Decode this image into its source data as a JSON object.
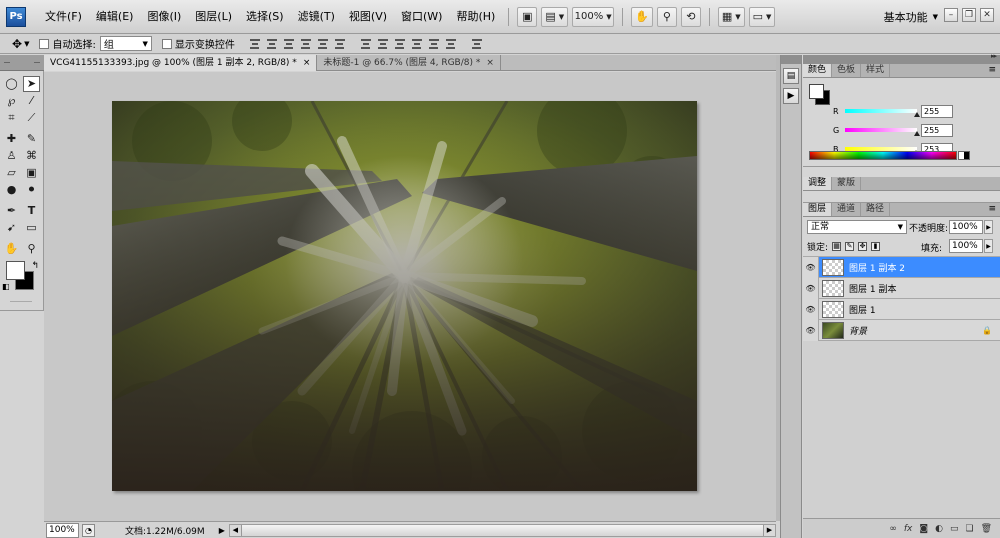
{
  "app": {
    "logo": "Ps",
    "menus": [
      "文件(F)",
      "编辑(E)",
      "图像(I)",
      "图层(L)",
      "选择(S)",
      "滤镜(T)",
      "视图(V)",
      "窗口(W)",
      "帮助(H)"
    ],
    "zoom_level": "100%",
    "workspace": "基本功能"
  },
  "options_bar": {
    "auto_select_label": "自动选择:",
    "auto_select_target": "组",
    "show_transform_label": "显示变换控件"
  },
  "documents": [
    {
      "title": "VCG41155133393.jpg @ 100% (图层 1 副本 2, RGB/8) *",
      "close": "×",
      "active": true
    },
    {
      "title": "未标题-1 @ 66.7% (图层 4, RGB/8) *",
      "close": "×",
      "active": false
    }
  ],
  "status": {
    "zoom": "100%",
    "doc_size": "文档:1.22M/6.09M"
  },
  "color_panel": {
    "tabs": [
      "颜色",
      "色板",
      "样式"
    ],
    "channels": [
      {
        "label": "R",
        "value": "255",
        "fraction": 1.0,
        "from": "#00ffff",
        "to": "#ffffff"
      },
      {
        "label": "G",
        "value": "255",
        "fraction": 1.0,
        "from": "#ff00ff",
        "to": "#ffffff"
      },
      {
        "label": "B",
        "value": "253",
        "fraction": 0.992,
        "from": "#ffff00",
        "to": "#ffffff"
      }
    ]
  },
  "adjust_panel": {
    "tabs": [
      "调整",
      "蒙版"
    ]
  },
  "layers_panel": {
    "tabs": [
      "图层",
      "通道",
      "路径"
    ],
    "blend_mode": "正常",
    "opacity_label": "不透明度:",
    "opacity": "100%",
    "lock_label": "锁定:",
    "fill_label": "填充:",
    "fill": "100%",
    "layers": [
      {
        "name": "图层 1 副本 2",
        "selected": true
      },
      {
        "name": "图层 1 副本",
        "selected": false
      },
      {
        "name": "图层 1",
        "selected": false
      },
      {
        "name": "背景",
        "selected": false,
        "locked": true
      }
    ]
  },
  "colors": {
    "selection": "#3c8cff",
    "chrome": "#d4d4d4"
  }
}
